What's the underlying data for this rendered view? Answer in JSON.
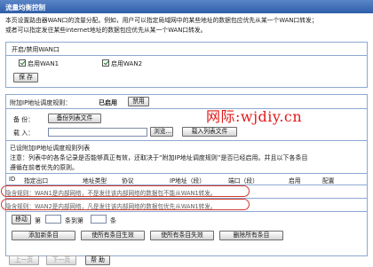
{
  "page": {
    "title": "流量均衡控制",
    "intro_line1": "本页设置路由器WAN口的流量分配。例如，用户可以指定局域网中的某些地址的数据包应优先从某一个WAN口转发；",
    "intro_line2": "或者可以指定发往某些internet地址的数据包应优先从某一个WAN口转发。"
  },
  "wan_section": {
    "header": "开启/禁用WAN口",
    "wan1_label": "启用WAN1",
    "wan1_checked": true,
    "wan2_label": "启用WAN2",
    "wan2_checked": true,
    "save_label": "保 存"
  },
  "rules_section": {
    "status_label": "附加IP地址调度规则：",
    "status_value": "已启用",
    "disable_label": "禁用",
    "backup_label": "备 份：",
    "backup_button": "备份列表文件",
    "load_label": "载 入：",
    "browse_button": "浏览...",
    "load_button": "载入列表文件",
    "list_title": "已设附加IP地址调度规则列表",
    "list_note_1": "注意：列表中的各条记录是否能够真正有效，还取决于“附加IP地址调度规则”是否已经启用。并且以下各条目",
    "list_note_2": "遵循在前者优先的原则。"
  },
  "table": {
    "headers": [
      "ID",
      "指定出口",
      "地址类型",
      "协议",
      "IP地址（段）",
      "端口（段）",
      "启用",
      "配置"
    ],
    "hint_rows": [
      "隐含规则：WAN1是内部网络，不是发往该内部网络的数据包不能从WAN1转发。",
      "隐含规则：WAN2是内部网络，凡是发往该内部网络的数据包优先从WAN1转发。"
    ]
  },
  "controls": {
    "move_button": "移动",
    "move_label_1": "第",
    "move_label_2": "条到第",
    "move_label_3": "条",
    "add_new": "添加新条目",
    "enable_all": "使所有条目生效",
    "disable_all": "使所有条目失效",
    "delete_all": "删除所有条目"
  },
  "footer": {
    "prev_page": "上一页",
    "next_page": "下一页",
    "help": "帮 助"
  },
  "watermark": "网际:wjdiy.cn",
  "colors": {
    "title_bar": "#2f5da8",
    "border": "#8ea8d2",
    "highlight_ring": "#d23a2a",
    "watermark": "#e01818"
  }
}
